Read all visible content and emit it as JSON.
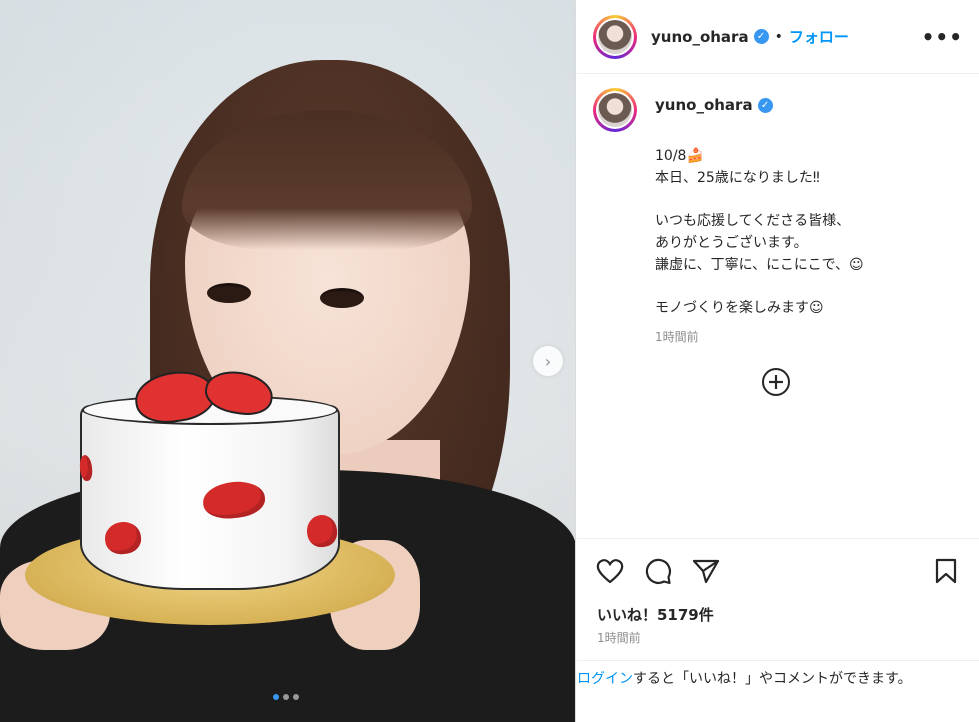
{
  "post": {
    "username": "yuno_ohara",
    "verified_badge": "✓",
    "separator": "•",
    "follow_label": "フォロー",
    "more_label": "•••",
    "caption": "10/8🍰\n本日、25歳になりました‼︎\n\nいつも応援してくださる皆様、\nありがとうございます。\n謙虚に、丁寧に、にこにこで、☺︎\n\nモノづくりを楽しみます☺︎",
    "caption_time": "1時間前",
    "likes": "いいね！5179件",
    "post_time": "1時間前",
    "login_link": "ログイン",
    "login_rest": "すると「いいね！」やコメントができます。"
  },
  "media": {
    "next_label": "›",
    "carousel_dots": [
      true,
      false,
      false
    ]
  },
  "icons": {
    "like": "heart-icon",
    "comment": "comment-icon",
    "share": "share-icon",
    "save": "bookmark-icon",
    "add_comment": "plus-circle-icon",
    "more": "more-icon"
  },
  "colors": {
    "accent": "#0095f6",
    "verified": "#3897f0",
    "text": "#262626",
    "muted": "#8e8e8e"
  }
}
